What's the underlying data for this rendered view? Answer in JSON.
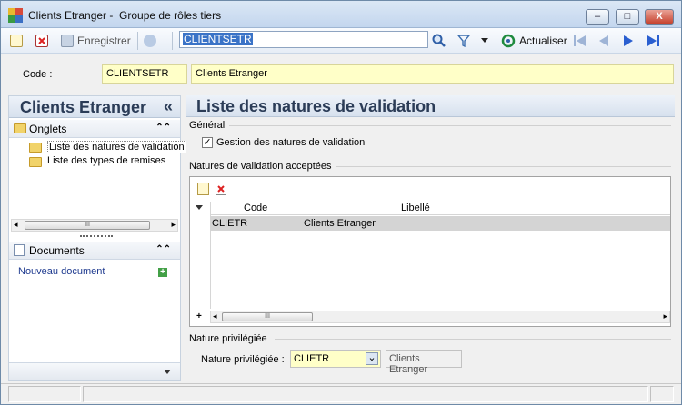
{
  "window": {
    "title": "Clients Etranger -  Groupe de rôles tiers",
    "minimize_glyph": "–",
    "maximize_glyph": "□",
    "close_glyph": "X"
  },
  "toolbar": {
    "save_label": "Enregistrer",
    "search_value": "CLIENTSETR",
    "refresh_label": "Actualiser",
    "icons": [
      "new-icon",
      "delete-icon",
      "save-icon",
      "sync-icon",
      "search-icon",
      "filter-icon",
      "dropdown-icon",
      "refresh-icon",
      "first-icon",
      "previous-icon",
      "next-icon",
      "last-icon"
    ]
  },
  "header": {
    "code_label": "Code :",
    "code_value": "CLIENTSETR",
    "name_value": "Clients Etranger"
  },
  "sidebar": {
    "title": "Clients Etranger",
    "collapse_glyph": "«",
    "onglets_label": "Onglets",
    "tabs": [
      {
        "label": "Liste des natures de validation"
      },
      {
        "label": "Liste des types de remises"
      }
    ],
    "documents_label": "Documents",
    "new_document_label": "Nouveau document",
    "scroll_left": "◂",
    "scroll_right": "▸",
    "scroll_grip": "III",
    "collapse_section_glyph": "⌃⌃"
  },
  "main": {
    "title": "Liste des natures de validation",
    "general_label": "Général",
    "checkbox_label": "Gestion des natures de validation",
    "checkbox_checked": "✓",
    "accepted_label": "Natures de validation acceptées",
    "columns": [
      "Code",
      "Libellé"
    ],
    "rows": [
      {
        "code": "CLIETR",
        "label": "Clients Etranger"
      }
    ],
    "grid_add": "+",
    "priv_group_label": "Nature privilégiée",
    "priv_field_label": "Nature privilégiée :",
    "priv_code": "CLIETR",
    "priv_name": "Clients Etranger",
    "priv_dropdown": "⌄"
  },
  "colors": {
    "accent": "#3a73c7",
    "field_yellow": "#ffffc8",
    "title_blue": "#2b3c57"
  }
}
